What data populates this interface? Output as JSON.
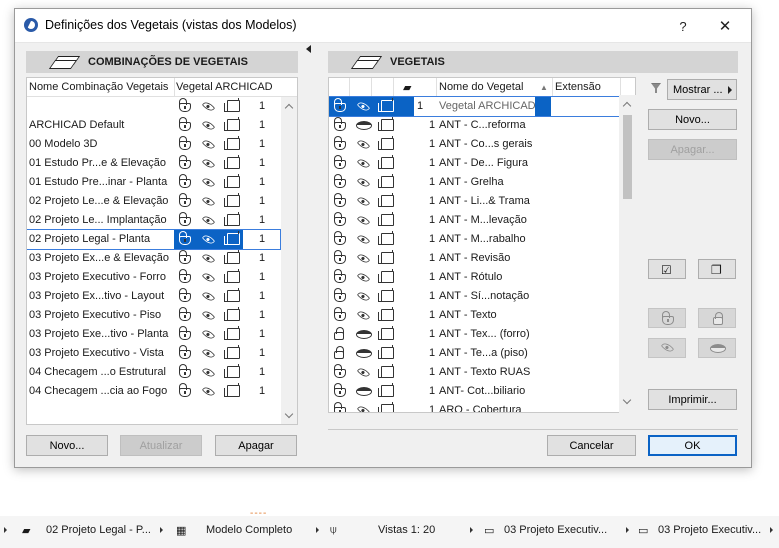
{
  "window": {
    "title": "Definições dos Vegetais (vistas dos Modelos)",
    "help_label": "?",
    "close_label": "✕"
  },
  "left_panel": {
    "header": "COMBINAÇÕES DE VEGETAIS",
    "col_name": "Nome Combinação Vegetais",
    "col_layer": "Vegetal ARCHICAD",
    "selected_index": 7,
    "items": [
      {
        "name": "",
        "value": "1"
      },
      {
        "name": "ARCHICAD Default",
        "value": "1"
      },
      {
        "name": "00 Modelo 3D",
        "value": "1"
      },
      {
        "name": "01 Estudo Pr...e & Elevação",
        "value": "1"
      },
      {
        "name": "01 Estudo Pre...inar - Planta",
        "value": "1"
      },
      {
        "name": "02 Projeto Le...e & Elevação",
        "value": "1"
      },
      {
        "name": "02 Projeto Le... Implantação",
        "value": "1"
      },
      {
        "name": "02 Projeto Legal - Planta",
        "value": "1"
      },
      {
        "name": "03 Projeto Ex...e & Elevação",
        "value": "1"
      },
      {
        "name": "03 Projeto Executivo - Forro",
        "value": "1"
      },
      {
        "name": "03 Projeto Ex...tivo - Layout",
        "value": "1"
      },
      {
        "name": "03 Projeto Executivo - Piso",
        "value": "1"
      },
      {
        "name": "03 Projeto Exe...tivo - Planta",
        "value": "1"
      },
      {
        "name": "03 Projeto Executivo - Vista",
        "value": "1"
      },
      {
        "name": "04 Checagem ...o Estrutural",
        "value": "1"
      },
      {
        "name": "04 Checagem ...cia ao Fogo",
        "value": "1"
      }
    ],
    "buttons": {
      "new": "Novo...",
      "update": "Atualizar",
      "delete": "Apagar"
    }
  },
  "right_panel": {
    "header": "VEGETAIS",
    "col_name": "Nome do Vegetal",
    "col_ext": "Extensão",
    "show_label": "Mostrar ...",
    "new_label": "Novo...",
    "delete_label": "Apagar...",
    "print_label": "Imprimir...",
    "layers": [
      {
        "name": "Vegetal ARCHICAD",
        "num": "1",
        "lock": "open",
        "eye": "open",
        "selected": true
      },
      {
        "name": "ANT - C...reforma",
        "num": "1",
        "lock": "open",
        "eye": "closed"
      },
      {
        "name": "ANT - Co...s gerais",
        "num": "1",
        "lock": "open",
        "eye": "open"
      },
      {
        "name": "ANT - De... Figura",
        "num": "1",
        "lock": "open",
        "eye": "open"
      },
      {
        "name": "ANT - Grelha",
        "num": "1",
        "lock": "open",
        "eye": "open"
      },
      {
        "name": "ANT - Li...& Trama",
        "num": "1",
        "lock": "open",
        "eye": "open"
      },
      {
        "name": "ANT - M...levação",
        "num": "1",
        "lock": "open",
        "eye": "open"
      },
      {
        "name": "ANT - M...rabalho",
        "num": "1",
        "lock": "open",
        "eye": "open"
      },
      {
        "name": "ANT - Revisão",
        "num": "1",
        "lock": "open",
        "eye": "open"
      },
      {
        "name": "ANT - Rótulo",
        "num": "1",
        "lock": "open",
        "eye": "open"
      },
      {
        "name": "ANT - Sí...notação",
        "num": "1",
        "lock": "open",
        "eye": "open"
      },
      {
        "name": "ANT - Texto",
        "num": "1",
        "lock": "open",
        "eye": "open"
      },
      {
        "name": "ANT - Tex... (forro)",
        "num": "1",
        "lock": "closed",
        "eye": "closed"
      },
      {
        "name": "ANT - Te...a (piso)",
        "num": "1",
        "lock": "closed",
        "eye": "closed"
      },
      {
        "name": "ANT - Texto RUAS",
        "num": "1",
        "lock": "open",
        "eye": "open"
      },
      {
        "name": "ANT- Cot...biliario",
        "num": "1",
        "lock": "open",
        "eye": "closed"
      },
      {
        "name": "ARQ - Cobertura",
        "num": "1",
        "lock": "open",
        "eye": "open"
      }
    ]
  },
  "dialog_buttons": {
    "cancel": "Cancelar",
    "ok": "OK"
  },
  "statusbar": {
    "layer_combo": "02 Projeto Legal - P...",
    "model": "Modelo Completo",
    "scale": "Vistas 1: 20",
    "view1": "03 Projeto Executiv...",
    "view2": "03 Projeto Executiv..."
  },
  "colors": {
    "selection": "#0b63c5",
    "accent_outline": "#3b7ddd"
  }
}
